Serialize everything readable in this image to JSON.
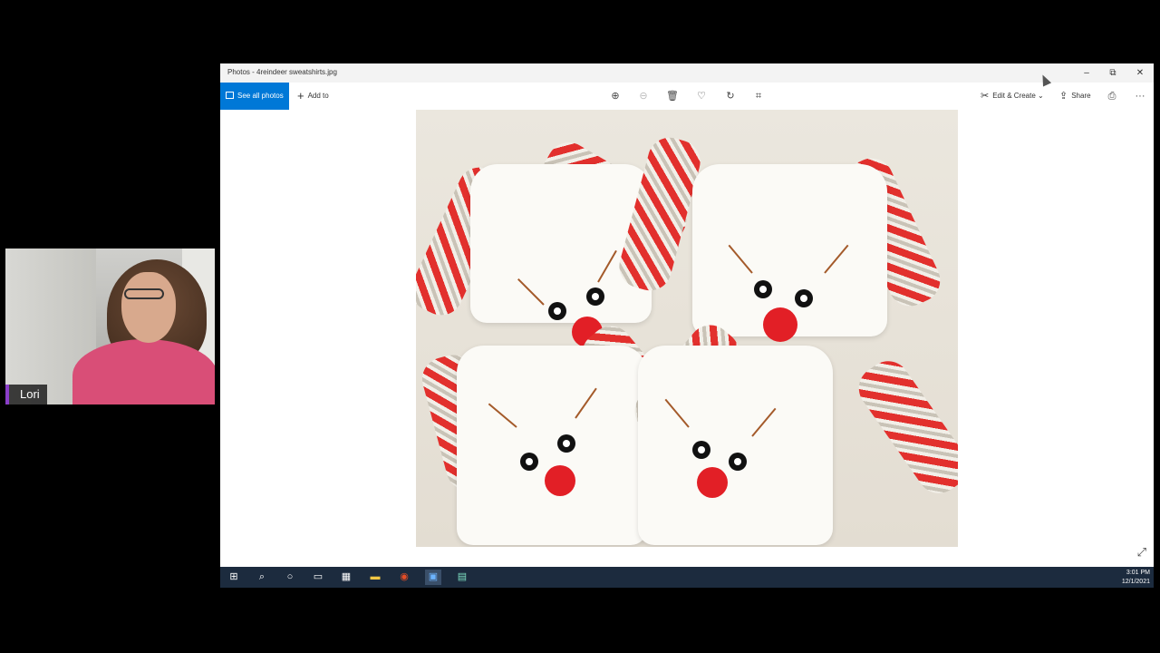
{
  "participant": {
    "name": "Lori"
  },
  "window": {
    "title": "Photos - 4reindeer sweatshirts.jpg",
    "controls": {
      "minimize": "–",
      "maximize": "⧉",
      "close": "✕"
    }
  },
  "toolbar": {
    "see_all_photos": "See all photos",
    "add_to": "Add to",
    "icons": [
      "zoom-in-icon",
      "zoom-out-icon",
      "delete-icon",
      "favorite-icon",
      "rotate-icon",
      "crop-icon"
    ],
    "edit_create": "Edit & Create",
    "share": "Share",
    "more": "···"
  },
  "taskbar": {
    "time": "3:01 PM",
    "date": "12/1/2021"
  },
  "colors": {
    "accent": "#0078d7",
    "taskbar": "#1c2b3e",
    "reindeer_red": "#e21f26"
  }
}
